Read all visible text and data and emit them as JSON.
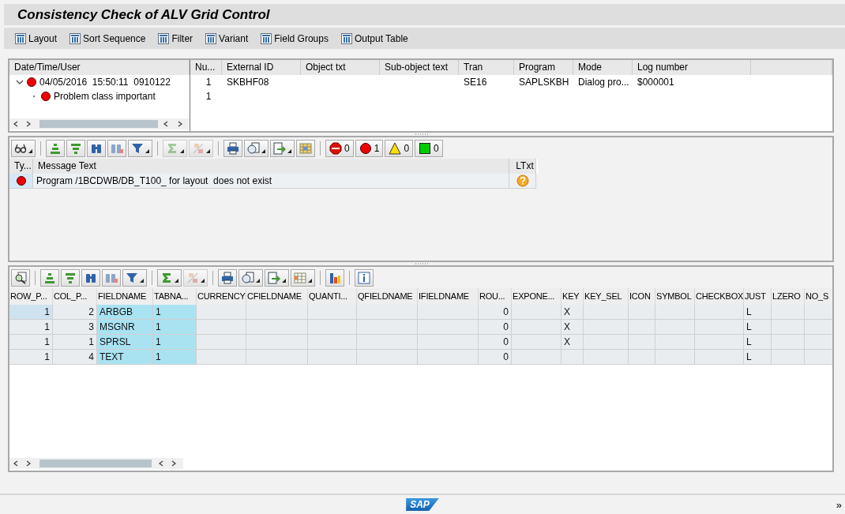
{
  "title": "Consistency Check of ALV Grid Control",
  "toolbar": [
    "Layout",
    "Sort Sequence",
    "Filter",
    "Variant",
    "Field Groups",
    "Output Table"
  ],
  "log_panel": {
    "tree_header": "Date/Time/User",
    "columns": [
      "Nu...",
      "External ID",
      "Object txt",
      "Sub-object text",
      "Tran",
      "Program",
      "Mode",
      "Log number"
    ],
    "rows": [
      {
        "label": "04/05/2016  15:50:11  0910122",
        "kind": "error",
        "expanded": true,
        "cells": [
          "1",
          "SKBHF08",
          null,
          null,
          "SE16",
          "SAPLSKBH",
          "Dialog pro...",
          "$000001"
        ],
        "children": [
          {
            "label": "Problem class important",
            "kind": "error",
            "cells": [
              "1"
            ]
          }
        ]
      }
    ]
  },
  "messages": {
    "counters": [
      {
        "kind": "stop",
        "count": "0"
      },
      {
        "kind": "error",
        "count": "1"
      },
      {
        "kind": "warning",
        "count": "0"
      },
      {
        "kind": "success",
        "count": "0"
      }
    ],
    "columns": [
      "Ty...",
      "Message Text",
      "LTxt"
    ],
    "rows": [
      {
        "kind": "error",
        "text": "Program /1BCDWB/DB_T100_ for layout  does not exist",
        "long_text": true
      }
    ]
  },
  "grid": {
    "columns": [
      {
        "label": "ROW_P...",
        "key_field": false
      },
      {
        "label": "COL_P...",
        "key_field": false
      },
      {
        "label": "FIELDNAME",
        "key_field": true
      },
      {
        "label": "TABNA...",
        "key_field": true
      },
      {
        "label": "CURRENCY",
        "key_field": false
      },
      {
        "label": "CFIELDNAME",
        "key_field": false
      },
      {
        "label": "QUANTI...",
        "key_field": false
      },
      {
        "label": "QFIELDNAME",
        "key_field": false
      },
      {
        "label": "IFIELDNAME",
        "key_field": false
      },
      {
        "label": "ROU...",
        "key_field": false
      },
      {
        "label": "EXPONE...",
        "key_field": false
      },
      {
        "label": "KEY",
        "key_field": false
      },
      {
        "label": "KEY_SEL",
        "key_field": false
      },
      {
        "label": "ICON",
        "key_field": false
      },
      {
        "label": "SYMBOL",
        "key_field": false
      },
      {
        "label": "CHECKBOX",
        "key_field": false
      },
      {
        "label": "JUST",
        "key_field": false
      },
      {
        "label": "LZERO",
        "key_field": false
      },
      {
        "label": "NO_S",
        "key_field": false
      }
    ],
    "rows": [
      {
        "selected": true,
        "cells": [
          "1",
          "2",
          "ARBGB",
          "1",
          null,
          null,
          null,
          null,
          null,
          "0",
          null,
          "X",
          null,
          null,
          null,
          null,
          "L",
          null,
          null
        ]
      },
      {
        "selected": false,
        "cells": [
          "1",
          "3",
          "MSGNR",
          "1",
          null,
          null,
          null,
          null,
          null,
          "0",
          null,
          "X",
          null,
          null,
          null,
          null,
          "L",
          null,
          null
        ]
      },
      {
        "selected": false,
        "cells": [
          "1",
          "1",
          "SPRSL",
          "1",
          null,
          null,
          null,
          null,
          null,
          "0",
          null,
          "X",
          null,
          null,
          null,
          null,
          "L",
          null,
          null
        ]
      },
      {
        "selected": false,
        "cells": [
          "1",
          "4",
          "TEXT",
          "1",
          null,
          null,
          null,
          null,
          null,
          "0",
          null,
          null,
          null,
          null,
          null,
          null,
          "L",
          null,
          null
        ]
      }
    ]
  },
  "status_bar": {
    "logo": "SAP",
    "expand": "»"
  }
}
